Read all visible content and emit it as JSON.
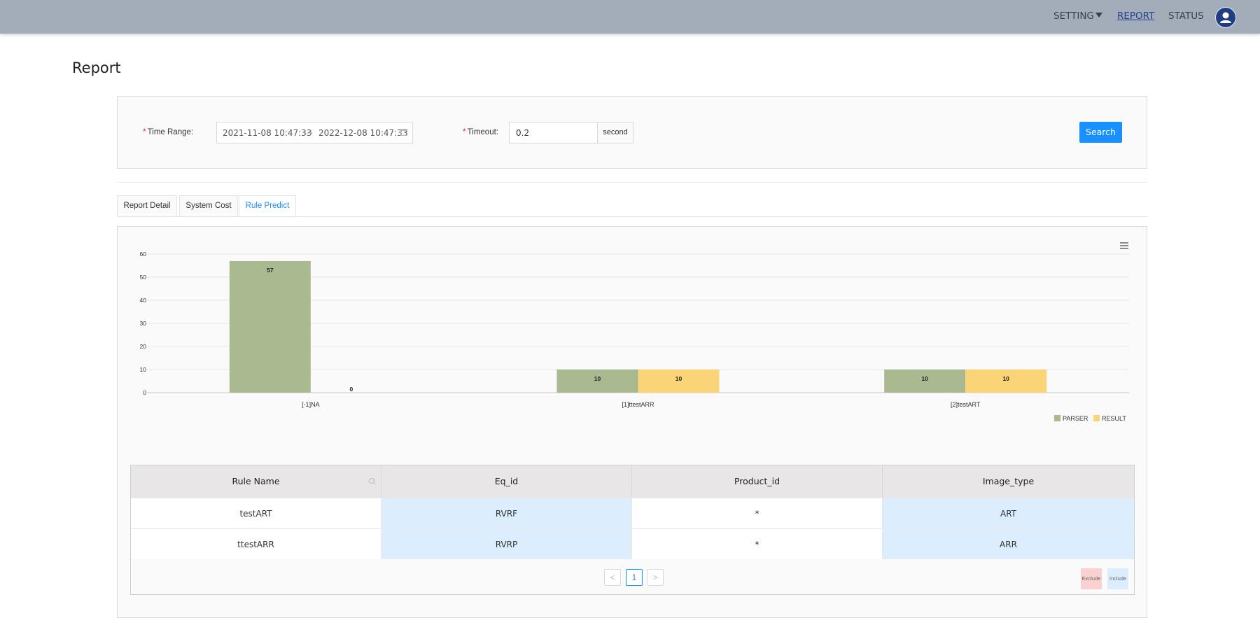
{
  "nav": {
    "setting": "SETTING",
    "report": "REPORT",
    "status": "STATUS"
  },
  "page": {
    "title": "Report"
  },
  "filters": {
    "time_range_label": "Time Range",
    "required_mark": "*",
    "range_start": "2021-11-08 10:47:33",
    "range_separator": "→",
    "range_end": "2022-12-08 10:47:33",
    "timeout_label": "Timeout",
    "timeout_value": "0.2",
    "timeout_unit": "second",
    "search_label": "Search"
  },
  "tabs": [
    {
      "label": "Report Detail"
    },
    {
      "label": "System Cost"
    },
    {
      "label": "Rule Predict",
      "active": true
    }
  ],
  "chart_data": {
    "type": "bar",
    "categories": [
      "[-1]NA",
      "[1]ttestARR",
      "[2]testART"
    ],
    "series": [
      {
        "name": "PARSER",
        "values": [
          57,
          10,
          10
        ],
        "color": "#a9ba91"
      },
      {
        "name": "RESULT",
        "values": [
          0,
          10,
          10
        ],
        "color": "#fad477"
      }
    ],
    "ylim": [
      0,
      60
    ],
    "yticks": [
      0,
      10,
      20,
      30,
      40,
      50,
      60
    ],
    "grid": true,
    "legend": "bottom-right",
    "title": "",
    "xlabel": "",
    "ylabel": ""
  },
  "table": {
    "columns": [
      "Rule Name",
      "Eq_id",
      "Product_id",
      "Image_type"
    ],
    "rows": [
      [
        "testART",
        "RVRF",
        "*",
        "ART"
      ],
      [
        "ttestARR",
        "RVRP",
        "*",
        "ARR"
      ]
    ],
    "pagination": {
      "prev": "<",
      "current": "1",
      "next": ">"
    },
    "legend": {
      "exclude": "Exclude",
      "include": "Include",
      "exclude_color": "#fbd1cf",
      "include_color": "#dcedfd"
    }
  }
}
